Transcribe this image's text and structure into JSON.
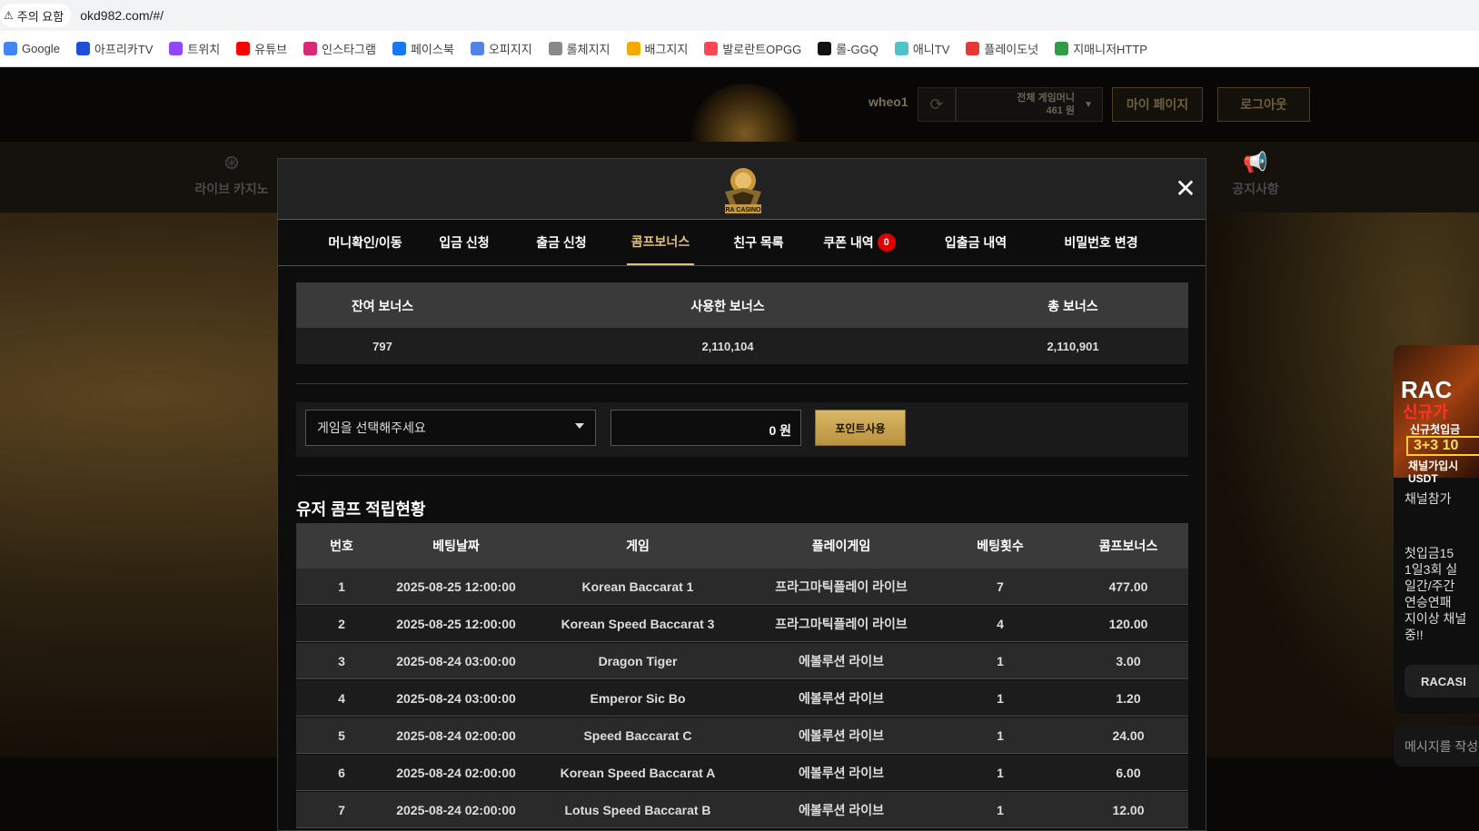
{
  "browser": {
    "security_label": "주의 요함",
    "url": "okd982.com/#/",
    "bookmarks": [
      {
        "label": "Google",
        "icon": "google-icon",
        "color": "#4285f4"
      },
      {
        "label": "아프리카TV",
        "icon": "afreecatv-icon",
        "color": "#1e4fd8"
      },
      {
        "label": "트위치",
        "icon": "twitch-icon",
        "color": "#9146ff"
      },
      {
        "label": "유튜브",
        "icon": "youtube-icon",
        "color": "#ff0000"
      },
      {
        "label": "인스타그램",
        "icon": "instagram-icon",
        "color": "#d62976"
      },
      {
        "label": "페이스북",
        "icon": "facebook-icon",
        "color": "#1877f2"
      },
      {
        "label": "오피지지",
        "icon": "opgg-icon",
        "color": "#5383e8"
      },
      {
        "label": "롤체지지",
        "icon": "lolchess-icon",
        "color": "#888888"
      },
      {
        "label": "배그지지",
        "icon": "pubg-icon",
        "color": "#f2a900"
      },
      {
        "label": "발로란트OPGG",
        "icon": "valorant-icon",
        "color": "#ff4655"
      },
      {
        "label": "롤-GGQ",
        "icon": "ggq-icon",
        "color": "#111111"
      },
      {
        "label": "애니TV",
        "icon": "anitv-icon",
        "color": "#4fc3c7"
      },
      {
        "label": "플레이도넛",
        "icon": "playdonut-icon",
        "color": "#e53935"
      },
      {
        "label": "지매니저HTTP",
        "icon": "gmanager-icon",
        "color": "#2e9e44"
      }
    ]
  },
  "header": {
    "username": "wheo1",
    "money_label": "전체 게임머니",
    "money_value": "461 원",
    "mypage_label": "마이 페이지",
    "logout_label": "로그아웃"
  },
  "nav": {
    "live_casino": "라이브 카지노",
    "notice": "공지사항"
  },
  "promo": {
    "brand": "RAC",
    "line1": "신규가",
    "line2": "신규첫입금",
    "line3": "3+3 10",
    "line4": "채널가입시",
    "line5": "USDT",
    "items": [
      "채널참가",
      "",
      "첫입금15",
      "1일3회 실",
      "일간/주간",
      "연승연패",
      "지이상 채널",
      "중!!"
    ],
    "button_label": "RACASI",
    "message_placeholder": "메시지를 작성"
  },
  "modal": {
    "logo_text": "RA CASINO",
    "tabs": [
      {
        "label": "머니확인/이동"
      },
      {
        "label": "입금 신청"
      },
      {
        "label": "출금 신청"
      },
      {
        "label": "콤프보너스"
      },
      {
        "label": "친구 목록"
      },
      {
        "label": "쿠폰 내역",
        "badge": "0"
      },
      {
        "label": "입출금 내역"
      },
      {
        "label": "비밀번호 변경"
      }
    ],
    "active_tab": "콤프보너스",
    "summary": {
      "headers": [
        "잔여 보너스",
        "사용한 보너스",
        "총 보너스"
      ],
      "values": [
        "797",
        "2,110,104",
        "2,110,901"
      ]
    },
    "use_form": {
      "select_placeholder": "게임을 선택해주세요",
      "amount_value": "0 원",
      "button_label": "포인트사용"
    },
    "section_title": "유저 콤프 적립현황",
    "table": {
      "columns": [
        "번호",
        "베팅날짜",
        "게임",
        "플레이게임",
        "베팅횟수",
        "콤프보너스"
      ],
      "rows": [
        [
          "1",
          "2025-08-25 12:00:00",
          "Korean Baccarat 1",
          "프라그마틱플레이 라이브",
          "7",
          "477.00"
        ],
        [
          "2",
          "2025-08-25 12:00:00",
          "Korean Speed Baccarat 3",
          "프라그마틱플레이 라이브",
          "4",
          "120.00"
        ],
        [
          "3",
          "2025-08-24 03:00:00",
          "Dragon Tiger",
          "에볼루션 라이브",
          "1",
          "3.00"
        ],
        [
          "4",
          "2025-08-24 03:00:00",
          "Emperor Sic Bo",
          "에볼루션 라이브",
          "1",
          "1.20"
        ],
        [
          "5",
          "2025-08-24 02:00:00",
          "Speed Baccarat C",
          "에볼루션 라이브",
          "1",
          "24.00"
        ],
        [
          "6",
          "2025-08-24 02:00:00",
          "Korean Speed Baccarat A",
          "에볼루션 라이브",
          "1",
          "6.00"
        ],
        [
          "7",
          "2025-08-24 02:00:00",
          "Lotus Speed Baccarat B",
          "에볼루션 라이브",
          "1",
          "12.00"
        ]
      ]
    }
  }
}
